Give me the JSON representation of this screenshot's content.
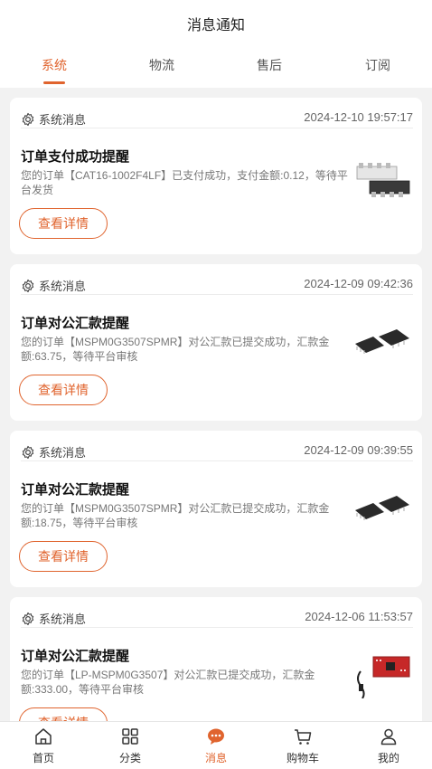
{
  "header": {
    "title": "消息通知"
  },
  "tabs": [
    {
      "label": "系统"
    },
    {
      "label": "物流"
    },
    {
      "label": "售后"
    },
    {
      "label": "订阅"
    }
  ],
  "active_tab": "系统",
  "messages": [
    {
      "type": "系统消息",
      "time": "2024-12-10 19:57:17",
      "title": "订单支付成功提醒",
      "desc": "您的订单【CAT16-1002F4LF】已支付成功，支付金额:0.12，等待平台发货",
      "button": "查看详情",
      "thumb": "resistor-array-image"
    },
    {
      "type": "系统消息",
      "time": "2024-12-09 09:42:36",
      "title": "订单对公汇款提醒",
      "desc": "您的订单【MSPM0G3507SPMR】对公汇款已提交成功，汇款金额:63.75，等待平台审核",
      "button": "查看详情",
      "thumb": "chip-image"
    },
    {
      "type": "系统消息",
      "time": "2024-12-09 09:39:55",
      "title": "订单对公汇款提醒",
      "desc": "您的订单【MSPM0G3507SPMR】对公汇款已提交成功，汇款金额:18.75，等待平台审核",
      "button": "查看详情",
      "thumb": "chip-image"
    },
    {
      "type": "系统消息",
      "time": "2024-12-06 11:53:57",
      "title": "订单对公汇款提醒",
      "desc": "您的订单【LP-MSPM0G3507】对公汇款已提交成功，汇款金额:333.00，等待平台审核",
      "button": "查看详情",
      "thumb": "dev-board-image"
    }
  ],
  "bottom_nav": [
    {
      "label": "首页",
      "icon": "home-icon"
    },
    {
      "label": "分类",
      "icon": "category-icon"
    },
    {
      "label": "消息",
      "icon": "message-icon"
    },
    {
      "label": "购物车",
      "icon": "cart-icon"
    },
    {
      "label": "我的",
      "icon": "user-icon"
    }
  ],
  "active_nav": "消息",
  "colors": {
    "accent": "#e0642e",
    "background": "#f2f2f2"
  }
}
